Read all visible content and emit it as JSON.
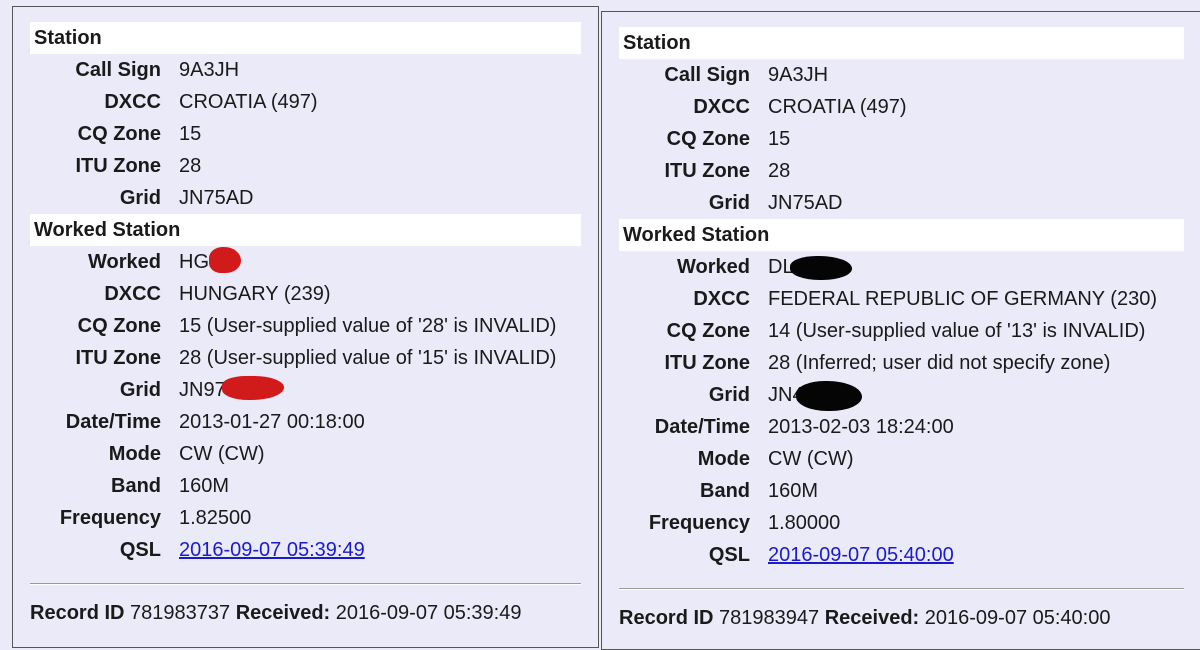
{
  "left": {
    "station_header": "Station",
    "station": [
      {
        "label": "Call Sign",
        "value": "9A3JH"
      },
      {
        "label": "DXCC",
        "value": "CROATIA (497)"
      },
      {
        "label": "CQ Zone",
        "value": "15"
      },
      {
        "label": "ITU Zone",
        "value": "28"
      },
      {
        "label": "Grid",
        "value": "JN75AD"
      }
    ],
    "worked_header": "Worked Station",
    "worked": [
      {
        "label": "Worked",
        "value": "HG"
      },
      {
        "label": "DXCC",
        "value": "HUNGARY (239)"
      },
      {
        "label": "CQ Zone",
        "value": "15 (User-supplied value of '28' is INVALID)"
      },
      {
        "label": "ITU Zone",
        "value": "28 (User-supplied value of '15' is INVALID)"
      },
      {
        "label": "Grid",
        "value": "JN97"
      },
      {
        "label": "Date/Time",
        "value": "2013-01-27 00:18:00"
      },
      {
        "label": "Mode",
        "value": "CW (CW)"
      },
      {
        "label": "Band",
        "value": "160M"
      },
      {
        "label": "Frequency",
        "value": "1.82500"
      },
      {
        "label": "QSL",
        "value": "2016-09-07 05:39:49"
      }
    ],
    "footer": {
      "record_id_label": "Record ID",
      "record_id": "781983737",
      "received_label": "Received:",
      "received": "2016-09-07 05:39:49"
    },
    "redaction_color": "#d11a1a"
  },
  "right": {
    "station_header": "Station",
    "station": [
      {
        "label": "Call Sign",
        "value": "9A3JH"
      },
      {
        "label": "DXCC",
        "value": "CROATIA (497)"
      },
      {
        "label": "CQ Zone",
        "value": "15"
      },
      {
        "label": "ITU Zone",
        "value": "28"
      },
      {
        "label": "Grid",
        "value": "JN75AD"
      }
    ],
    "worked_header": "Worked Station",
    "worked": [
      {
        "label": "Worked",
        "value": "DL"
      },
      {
        "label": "DXCC",
        "value": "FEDERAL REPUBLIC OF GERMANY (230)"
      },
      {
        "label": "CQ Zone",
        "value": "14 (User-supplied value of '13' is INVALID)"
      },
      {
        "label": "ITU Zone",
        "value": "28 (Inferred; user did not specify zone)"
      },
      {
        "label": "Grid",
        "value": "JN4"
      },
      {
        "label": "Date/Time",
        "value": "2013-02-03 18:24:00"
      },
      {
        "label": "Mode",
        "value": "CW (CW)"
      },
      {
        "label": "Band",
        "value": "160M"
      },
      {
        "label": "Frequency",
        "value": "1.80000"
      },
      {
        "label": "QSL",
        "value": "2016-09-07 05:40:00"
      }
    ],
    "footer": {
      "record_id_label": "Record ID",
      "record_id": "781983947",
      "received_label": "Received:",
      "received": "2016-09-07 05:40:00"
    },
    "redaction_color": "#050505"
  }
}
